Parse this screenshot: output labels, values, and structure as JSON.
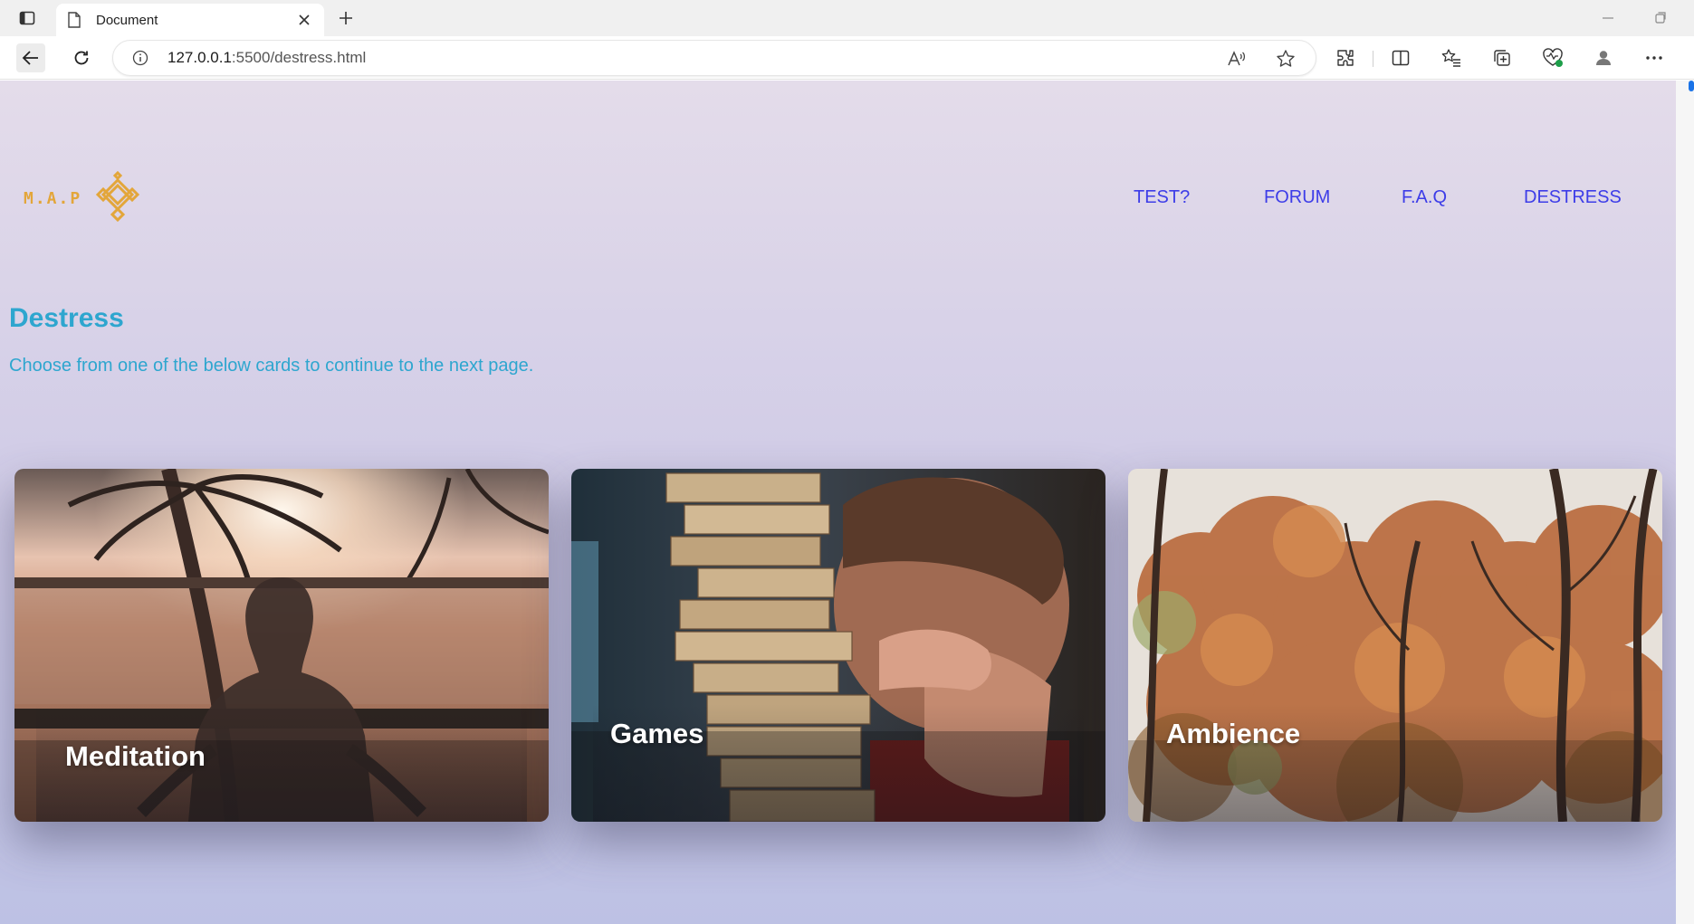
{
  "browser": {
    "tab_title": "Document",
    "url_host": "127.0.0.1",
    "url_rest": ":5500/destress.html"
  },
  "logo": {
    "text": "M.A.P",
    "color": "#e3a63a"
  },
  "nav": {
    "items": [
      "TEST?",
      "FORUM",
      "F.A.Q",
      "DESTRESS"
    ],
    "color": "#3d3de8"
  },
  "header": {
    "title": "Destress",
    "subtitle": "Choose from one of the below cards to continue to the next page.",
    "color": "#2ea6cf"
  },
  "cards": [
    {
      "label": "Meditation",
      "image": "sunset-meditation-photo"
    },
    {
      "label": "Games",
      "image": "jenga-tower-photo"
    },
    {
      "label": "Ambience",
      "image": "autumn-forest-photo"
    }
  ]
}
